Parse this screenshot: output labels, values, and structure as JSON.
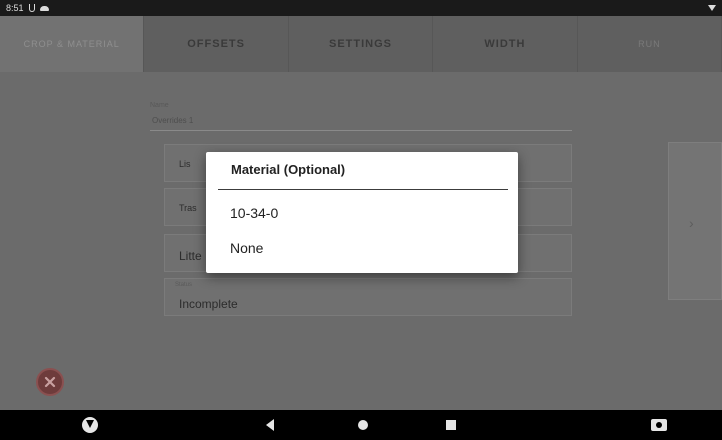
{
  "status_bar": {
    "time": "8:51"
  },
  "tabs": [
    {
      "label": "CROP & MATERIAL"
    },
    {
      "label": "OFFSETS"
    },
    {
      "label": "SETTINGS"
    },
    {
      "label": "WIDTH"
    },
    {
      "label": "RUN"
    }
  ],
  "background_form": {
    "field1_label": "Name",
    "field1_value": "Overrides 1",
    "card1_value": "Lis",
    "card2_value": "Tras",
    "card3_value": "Litte",
    "card4_label": "Status",
    "card4_value": "Incomplete"
  },
  "dialog": {
    "title": "Material (Optional)",
    "options": [
      "10-34-0",
      "None"
    ]
  },
  "colors": {
    "dialog_bg": "#ffffff",
    "scrim": "#6b6b6b",
    "close_fab": "#6e3b3b"
  }
}
